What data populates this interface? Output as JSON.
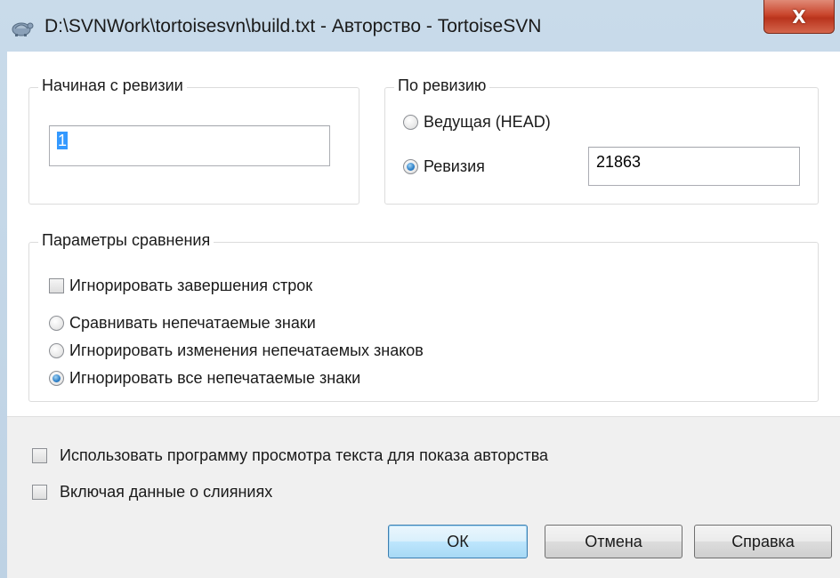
{
  "window": {
    "title": "D:\\SVNWork\\tortoisesvn\\build.txt - Авторство - TortoiseSVN",
    "close_glyph": "X"
  },
  "from_revision": {
    "legend": "Начиная с ревизии",
    "value": "1"
  },
  "to_revision": {
    "legend": "По ревизию",
    "head_label": "Ведущая (HEAD)",
    "revision_label": "Ревизия",
    "revision_value": "21863",
    "selected": "revision"
  },
  "diff_options": {
    "legend": "Параметры сравнения",
    "ignore_eol_label": "Игнорировать завершения строк",
    "ignore_eol_checked": false,
    "whitespace_options": [
      "Сравнивать непечатаемые знаки",
      "Игнорировать изменения непечатаемых знаков",
      "Игнорировать все непечатаемые знаки"
    ],
    "whitespace_selected": 2
  },
  "bottom": {
    "use_text_viewer_label": "Использовать программу просмотра текста для показа авторства",
    "use_text_viewer_checked": false,
    "include_merge_label": "Включая данные о слияниях",
    "include_merge_checked": false
  },
  "buttons": {
    "ok": "ОК",
    "cancel": "Отмена",
    "help": "Справка"
  }
}
